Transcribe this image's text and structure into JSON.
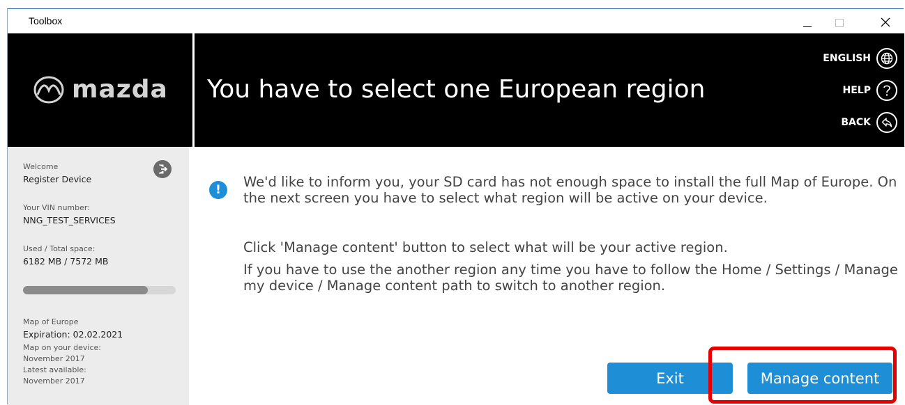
{
  "window": {
    "title": "Toolbox"
  },
  "header": {
    "brand": "mazda",
    "page_title": "You have to select one European region",
    "language_label": "ENGLISH",
    "help_label": "HELP",
    "back_label": "BACK"
  },
  "sidebar": {
    "welcome_label": "Welcome",
    "device_name": "Register Device",
    "vin_label": "Your VIN number:",
    "vin_value": "NNG_TEST_SERVICES",
    "space_label": "Used / Total space:",
    "space_value": "6182 MB / 7572 MB",
    "space_used_fraction": 0.816,
    "map_name": "Map of Europe",
    "expiration": "Expiration: 02.02.2021",
    "map_on_device_label": "Map on your device:",
    "map_on_device_value": "November 2017",
    "latest_label": "Latest available:",
    "latest_value": "November 2017"
  },
  "content": {
    "paragraph1": "We'd like to inform you, your SD card has not enough space to install the full Map of Europe. On the next screen you have to select what region will be active on your device.",
    "paragraph2": "Click 'Manage content' button to select what will be your active region.",
    "paragraph3": "If you have to use the another region any time you have to follow the Home / Settings / Manage my device / Manage content path to switch to another region."
  },
  "buttons": {
    "exit_label": "Exit",
    "manage_label": "Manage content"
  },
  "colors": {
    "accent_blue": "#1e8fd6",
    "highlight_red": "#e60000",
    "header_black": "#000000",
    "sidebar_gray": "#ececec"
  },
  "icons": {
    "logo": "mazda-logo-icon",
    "language": "globe-icon",
    "help": "question-icon",
    "back": "back-arrow-icon",
    "logout": "logout-icon",
    "info": "info-icon"
  }
}
